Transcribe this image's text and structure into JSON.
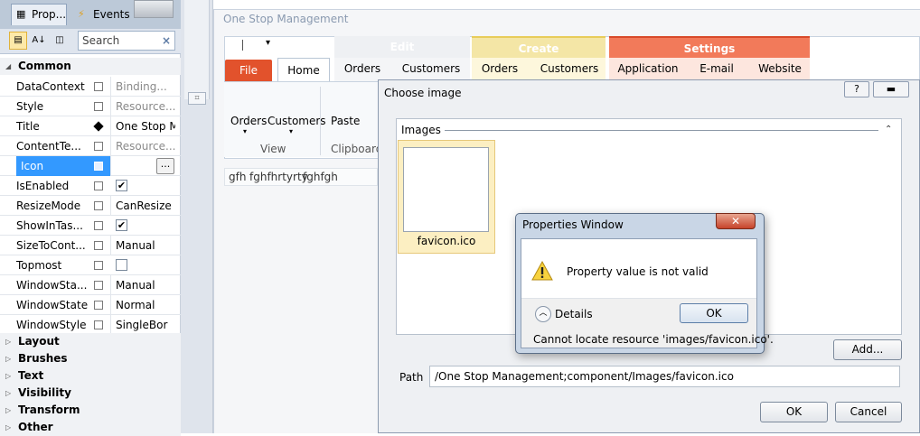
{
  "props": {
    "tabs": [
      {
        "label": "Prop..."
      },
      {
        "label": "Events"
      }
    ],
    "search_placeholder": "Search",
    "categories": {
      "common": "Common",
      "layout": "Layout",
      "brushes": "Brushes",
      "text": "Text",
      "visibility": "Visibility",
      "transform": "Transform",
      "other": "Other"
    },
    "rows": [
      {
        "name": "DataContext",
        "value": "Binding..."
      },
      {
        "name": "Style",
        "value": "Resource..."
      },
      {
        "name": "Title",
        "value": "One Stop M"
      },
      {
        "name": "ContentTe...",
        "value": "Resource..."
      },
      {
        "name": "Icon",
        "value": "",
        "button": "..."
      },
      {
        "name": "IsEnabled",
        "checked": true
      },
      {
        "name": "ResizeMode",
        "value": "CanResize"
      },
      {
        "name": "ShowInTas...",
        "checked": true
      },
      {
        "name": "SizeToCont...",
        "value": "Manual"
      },
      {
        "name": "Topmost",
        "checked": false
      },
      {
        "name": "WindowSta...",
        "value": "Manual"
      },
      {
        "name": "WindowState",
        "value": "Normal"
      },
      {
        "name": "WindowStyle",
        "value": "SingleBor"
      }
    ]
  },
  "app": {
    "title": "One Stop Management",
    "context_headers": {
      "edit": "Edit",
      "create": "Create",
      "settings": "Settings"
    },
    "tabs": {
      "file": "File",
      "home": "Home",
      "orders1": "Orders",
      "customers1": "Customers",
      "orders2": "Orders",
      "customers2": "Customers",
      "application": "Application",
      "email": "E-mail",
      "website": "Website"
    },
    "ribbon": {
      "orders_btn": "Orders",
      "customers_btn": "Customers",
      "paste_btn": "Paste",
      "view_group": "View",
      "clipboard_group": "Clipboard"
    },
    "doc_tabs": [
      "gfh",
      "fghfhrtyrty",
      "fghfgh"
    ]
  },
  "choose_image": {
    "title": "Choose image",
    "help_btn": "?",
    "images_header": "Images",
    "thumbnail_label": "favicon.ico",
    "add_button": "Add...",
    "path_label": "Path",
    "path_value": "/One Stop Management;component/Images/favicon.ico",
    "ok_button": "OK",
    "cancel_button": "Cancel"
  },
  "message": {
    "title": "Properties Window",
    "text": "Property value is not valid",
    "details_label": "Details",
    "ok_button": "OK",
    "detail_text": "Cannot locate resource 'images/favicon.ico'."
  },
  "colors": {
    "file_tab": "#e2522c",
    "settings_context": "#f27a5a",
    "create_context": "#f4e6a6",
    "selection": "#3399ff"
  }
}
